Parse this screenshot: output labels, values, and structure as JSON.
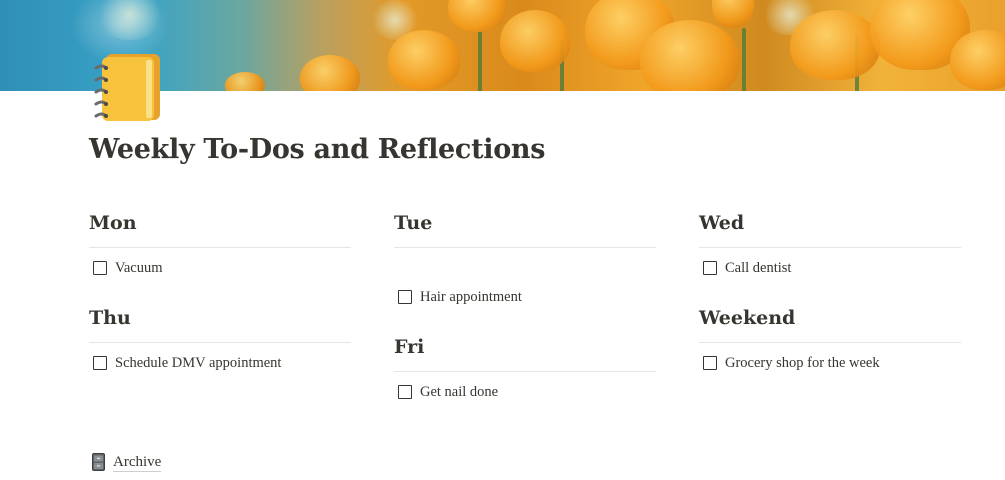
{
  "cover": {
    "description_icon": "poppy-flowers-cover-image"
  },
  "page": {
    "icon": "spiral-notebook-icon",
    "title": "Weekly To-Dos and Reflections"
  },
  "days": {
    "mon": {
      "heading": "Mon",
      "todos": [
        "Vacuum"
      ]
    },
    "tue": {
      "heading": "Tue",
      "todos": [
        "Hair appointment"
      ]
    },
    "wed": {
      "heading": "Wed",
      "todos": [
        "Call dentist"
      ]
    },
    "thu": {
      "heading": "Thu",
      "todos": [
        "Schedule DMV appointment"
      ]
    },
    "fri": {
      "heading": "Fri",
      "todos": [
        "Get nail done"
      ]
    },
    "weekend": {
      "heading": "Weekend",
      "todos": [
        "Grocery shop for the week"
      ]
    }
  },
  "archive": {
    "icon": "file-cabinet-icon",
    "label": "Archive"
  },
  "colors": {
    "text": "#37352f",
    "divider": "#e6e5e2"
  }
}
